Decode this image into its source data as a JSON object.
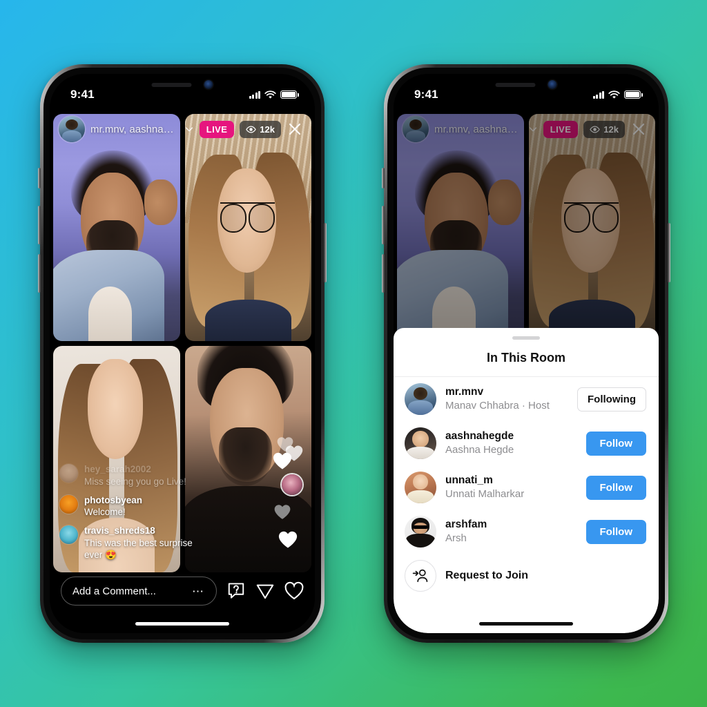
{
  "background": {
    "from": "#27b6ec",
    "mid": "#36c59e",
    "to": "#3cb44a"
  },
  "colors": {
    "live_badge": "#E6157E",
    "follow_blue": "#3897F0",
    "text_muted": "#8d8d90"
  },
  "phones": {
    "live": {
      "status_bar": {
        "time": "9:41",
        "signal_icon": "cellular-bars-icon",
        "wifi_icon": "wifi-icon",
        "battery_icon": "battery-icon"
      },
      "header": {
        "host_avatar": "host-avatar",
        "participants_label": "mr.mnv, aashnahe...",
        "chevron_icon": "chevron-down-icon",
        "live_badge": "LIVE",
        "viewers": "12k",
        "viewers_icon": "eye-icon",
        "close_icon": "close-icon"
      },
      "tiles": [
        {
          "name": "participant-video-1"
        },
        {
          "name": "participant-video-2"
        },
        {
          "name": "participant-video-3"
        },
        {
          "name": "participant-video-4"
        }
      ],
      "comments": [
        {
          "user": "hey_sarah2002",
          "text": "Miss seeing you go Live!",
          "faded": true
        },
        {
          "user": "photosbyean",
          "text": "Welcome!",
          "faded": false
        },
        {
          "user": "travis_shreds18",
          "text": "This was the best surprise ever 😍",
          "faded": false
        }
      ],
      "bottom_bar": {
        "comment_placeholder": "Add a Comment...",
        "more_icon": "ellipsis-icon",
        "question_icon": "question-bubble-icon",
        "share_icon": "paper-plane-icon",
        "like_icon": "heart-icon"
      },
      "home_indicator": "home-indicator"
    },
    "room": {
      "status_bar": {
        "time": "9:41",
        "signal_icon": "cellular-bars-icon",
        "wifi_icon": "wifi-icon",
        "battery_icon": "battery-icon"
      },
      "header": {
        "participants_label": "mr.mnv, aashnahe...",
        "chevron_icon": "chevron-down-icon",
        "live_badge": "LIVE",
        "viewers": "12k",
        "viewers_icon": "eye-icon",
        "close_icon": "close-icon"
      },
      "sheet": {
        "grabber": "sheet-grabber",
        "title": "In This Room",
        "members": [
          {
            "username": "mr.mnv",
            "fullname": "Manav Chhabra · Host",
            "action": "Following",
            "action_style": "following"
          },
          {
            "username": "aashnahegde",
            "fullname": "Aashna Hegde",
            "action": "Follow",
            "action_style": "follow"
          },
          {
            "username": "unnati_m",
            "fullname": "Unnati Malharkar",
            "action": "Follow",
            "action_style": "follow"
          },
          {
            "username": "arshfam",
            "fullname": "Arsh",
            "action": "Follow",
            "action_style": "follow"
          }
        ],
        "request_row": {
          "icon": "person-add-icon",
          "label": "Request to Join"
        }
      },
      "home_indicator": "home-indicator"
    }
  }
}
